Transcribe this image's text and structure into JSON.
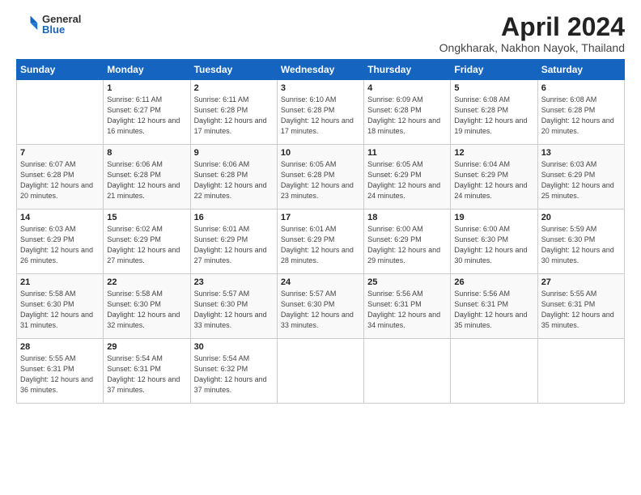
{
  "logo": {
    "general": "General",
    "blue": "Blue"
  },
  "title": "April 2024",
  "subtitle": "Ongkharak, Nakhon Nayok, Thailand",
  "days_of_week": [
    "Sunday",
    "Monday",
    "Tuesday",
    "Wednesday",
    "Thursday",
    "Friday",
    "Saturday"
  ],
  "weeks": [
    [
      {
        "day": "",
        "sunrise": "",
        "sunset": "",
        "daylight": ""
      },
      {
        "day": "1",
        "sunrise": "Sunrise: 6:11 AM",
        "sunset": "Sunset: 6:27 PM",
        "daylight": "Daylight: 12 hours and 16 minutes."
      },
      {
        "day": "2",
        "sunrise": "Sunrise: 6:11 AM",
        "sunset": "Sunset: 6:28 PM",
        "daylight": "Daylight: 12 hours and 17 minutes."
      },
      {
        "day": "3",
        "sunrise": "Sunrise: 6:10 AM",
        "sunset": "Sunset: 6:28 PM",
        "daylight": "Daylight: 12 hours and 17 minutes."
      },
      {
        "day": "4",
        "sunrise": "Sunrise: 6:09 AM",
        "sunset": "Sunset: 6:28 PM",
        "daylight": "Daylight: 12 hours and 18 minutes."
      },
      {
        "day": "5",
        "sunrise": "Sunrise: 6:08 AM",
        "sunset": "Sunset: 6:28 PM",
        "daylight": "Daylight: 12 hours and 19 minutes."
      },
      {
        "day": "6",
        "sunrise": "Sunrise: 6:08 AM",
        "sunset": "Sunset: 6:28 PM",
        "daylight": "Daylight: 12 hours and 20 minutes."
      }
    ],
    [
      {
        "day": "7",
        "sunrise": "Sunrise: 6:07 AM",
        "sunset": "Sunset: 6:28 PM",
        "daylight": "Daylight: 12 hours and 20 minutes."
      },
      {
        "day": "8",
        "sunrise": "Sunrise: 6:06 AM",
        "sunset": "Sunset: 6:28 PM",
        "daylight": "Daylight: 12 hours and 21 minutes."
      },
      {
        "day": "9",
        "sunrise": "Sunrise: 6:06 AM",
        "sunset": "Sunset: 6:28 PM",
        "daylight": "Daylight: 12 hours and 22 minutes."
      },
      {
        "day": "10",
        "sunrise": "Sunrise: 6:05 AM",
        "sunset": "Sunset: 6:28 PM",
        "daylight": "Daylight: 12 hours and 23 minutes."
      },
      {
        "day": "11",
        "sunrise": "Sunrise: 6:05 AM",
        "sunset": "Sunset: 6:29 PM",
        "daylight": "Daylight: 12 hours and 24 minutes."
      },
      {
        "day": "12",
        "sunrise": "Sunrise: 6:04 AM",
        "sunset": "Sunset: 6:29 PM",
        "daylight": "Daylight: 12 hours and 24 minutes."
      },
      {
        "day": "13",
        "sunrise": "Sunrise: 6:03 AM",
        "sunset": "Sunset: 6:29 PM",
        "daylight": "Daylight: 12 hours and 25 minutes."
      }
    ],
    [
      {
        "day": "14",
        "sunrise": "Sunrise: 6:03 AM",
        "sunset": "Sunset: 6:29 PM",
        "daylight": "Daylight: 12 hours and 26 minutes."
      },
      {
        "day": "15",
        "sunrise": "Sunrise: 6:02 AM",
        "sunset": "Sunset: 6:29 PM",
        "daylight": "Daylight: 12 hours and 27 minutes."
      },
      {
        "day": "16",
        "sunrise": "Sunrise: 6:01 AM",
        "sunset": "Sunset: 6:29 PM",
        "daylight": "Daylight: 12 hours and 27 minutes."
      },
      {
        "day": "17",
        "sunrise": "Sunrise: 6:01 AM",
        "sunset": "Sunset: 6:29 PM",
        "daylight": "Daylight: 12 hours and 28 minutes."
      },
      {
        "day": "18",
        "sunrise": "Sunrise: 6:00 AM",
        "sunset": "Sunset: 6:29 PM",
        "daylight": "Daylight: 12 hours and 29 minutes."
      },
      {
        "day": "19",
        "sunrise": "Sunrise: 6:00 AM",
        "sunset": "Sunset: 6:30 PM",
        "daylight": "Daylight: 12 hours and 30 minutes."
      },
      {
        "day": "20",
        "sunrise": "Sunrise: 5:59 AM",
        "sunset": "Sunset: 6:30 PM",
        "daylight": "Daylight: 12 hours and 30 minutes."
      }
    ],
    [
      {
        "day": "21",
        "sunrise": "Sunrise: 5:58 AM",
        "sunset": "Sunset: 6:30 PM",
        "daylight": "Daylight: 12 hours and 31 minutes."
      },
      {
        "day": "22",
        "sunrise": "Sunrise: 5:58 AM",
        "sunset": "Sunset: 6:30 PM",
        "daylight": "Daylight: 12 hours and 32 minutes."
      },
      {
        "day": "23",
        "sunrise": "Sunrise: 5:57 AM",
        "sunset": "Sunset: 6:30 PM",
        "daylight": "Daylight: 12 hours and 33 minutes."
      },
      {
        "day": "24",
        "sunrise": "Sunrise: 5:57 AM",
        "sunset": "Sunset: 6:30 PM",
        "daylight": "Daylight: 12 hours and 33 minutes."
      },
      {
        "day": "25",
        "sunrise": "Sunrise: 5:56 AM",
        "sunset": "Sunset: 6:31 PM",
        "daylight": "Daylight: 12 hours and 34 minutes."
      },
      {
        "day": "26",
        "sunrise": "Sunrise: 5:56 AM",
        "sunset": "Sunset: 6:31 PM",
        "daylight": "Daylight: 12 hours and 35 minutes."
      },
      {
        "day": "27",
        "sunrise": "Sunrise: 5:55 AM",
        "sunset": "Sunset: 6:31 PM",
        "daylight": "Daylight: 12 hours and 35 minutes."
      }
    ],
    [
      {
        "day": "28",
        "sunrise": "Sunrise: 5:55 AM",
        "sunset": "Sunset: 6:31 PM",
        "daylight": "Daylight: 12 hours and 36 minutes."
      },
      {
        "day": "29",
        "sunrise": "Sunrise: 5:54 AM",
        "sunset": "Sunset: 6:31 PM",
        "daylight": "Daylight: 12 hours and 37 minutes."
      },
      {
        "day": "30",
        "sunrise": "Sunrise: 5:54 AM",
        "sunset": "Sunset: 6:32 PM",
        "daylight": "Daylight: 12 hours and 37 minutes."
      },
      {
        "day": "",
        "sunrise": "",
        "sunset": "",
        "daylight": ""
      },
      {
        "day": "",
        "sunrise": "",
        "sunset": "",
        "daylight": ""
      },
      {
        "day": "",
        "sunrise": "",
        "sunset": "",
        "daylight": ""
      },
      {
        "day": "",
        "sunrise": "",
        "sunset": "",
        "daylight": ""
      }
    ]
  ]
}
